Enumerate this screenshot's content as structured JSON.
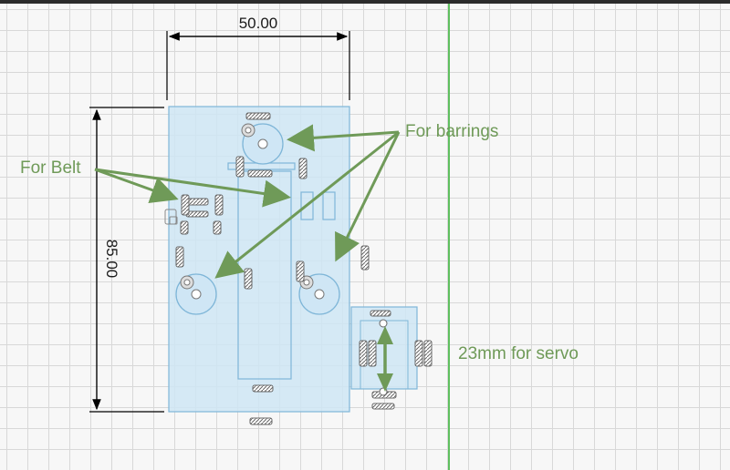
{
  "dimensions": {
    "width_label": "50.00",
    "height_label": "85.00"
  },
  "annotations": {
    "belt": "For Belt",
    "bearings": "For barrings",
    "servo": "23mm for servo"
  },
  "colors": {
    "body_fill": "#cfe6f5",
    "body_stroke": "#7fb6d8",
    "annotation": "#6f9a58",
    "origin_axis": "#5fbf5f",
    "dimension_line": "#000000"
  }
}
